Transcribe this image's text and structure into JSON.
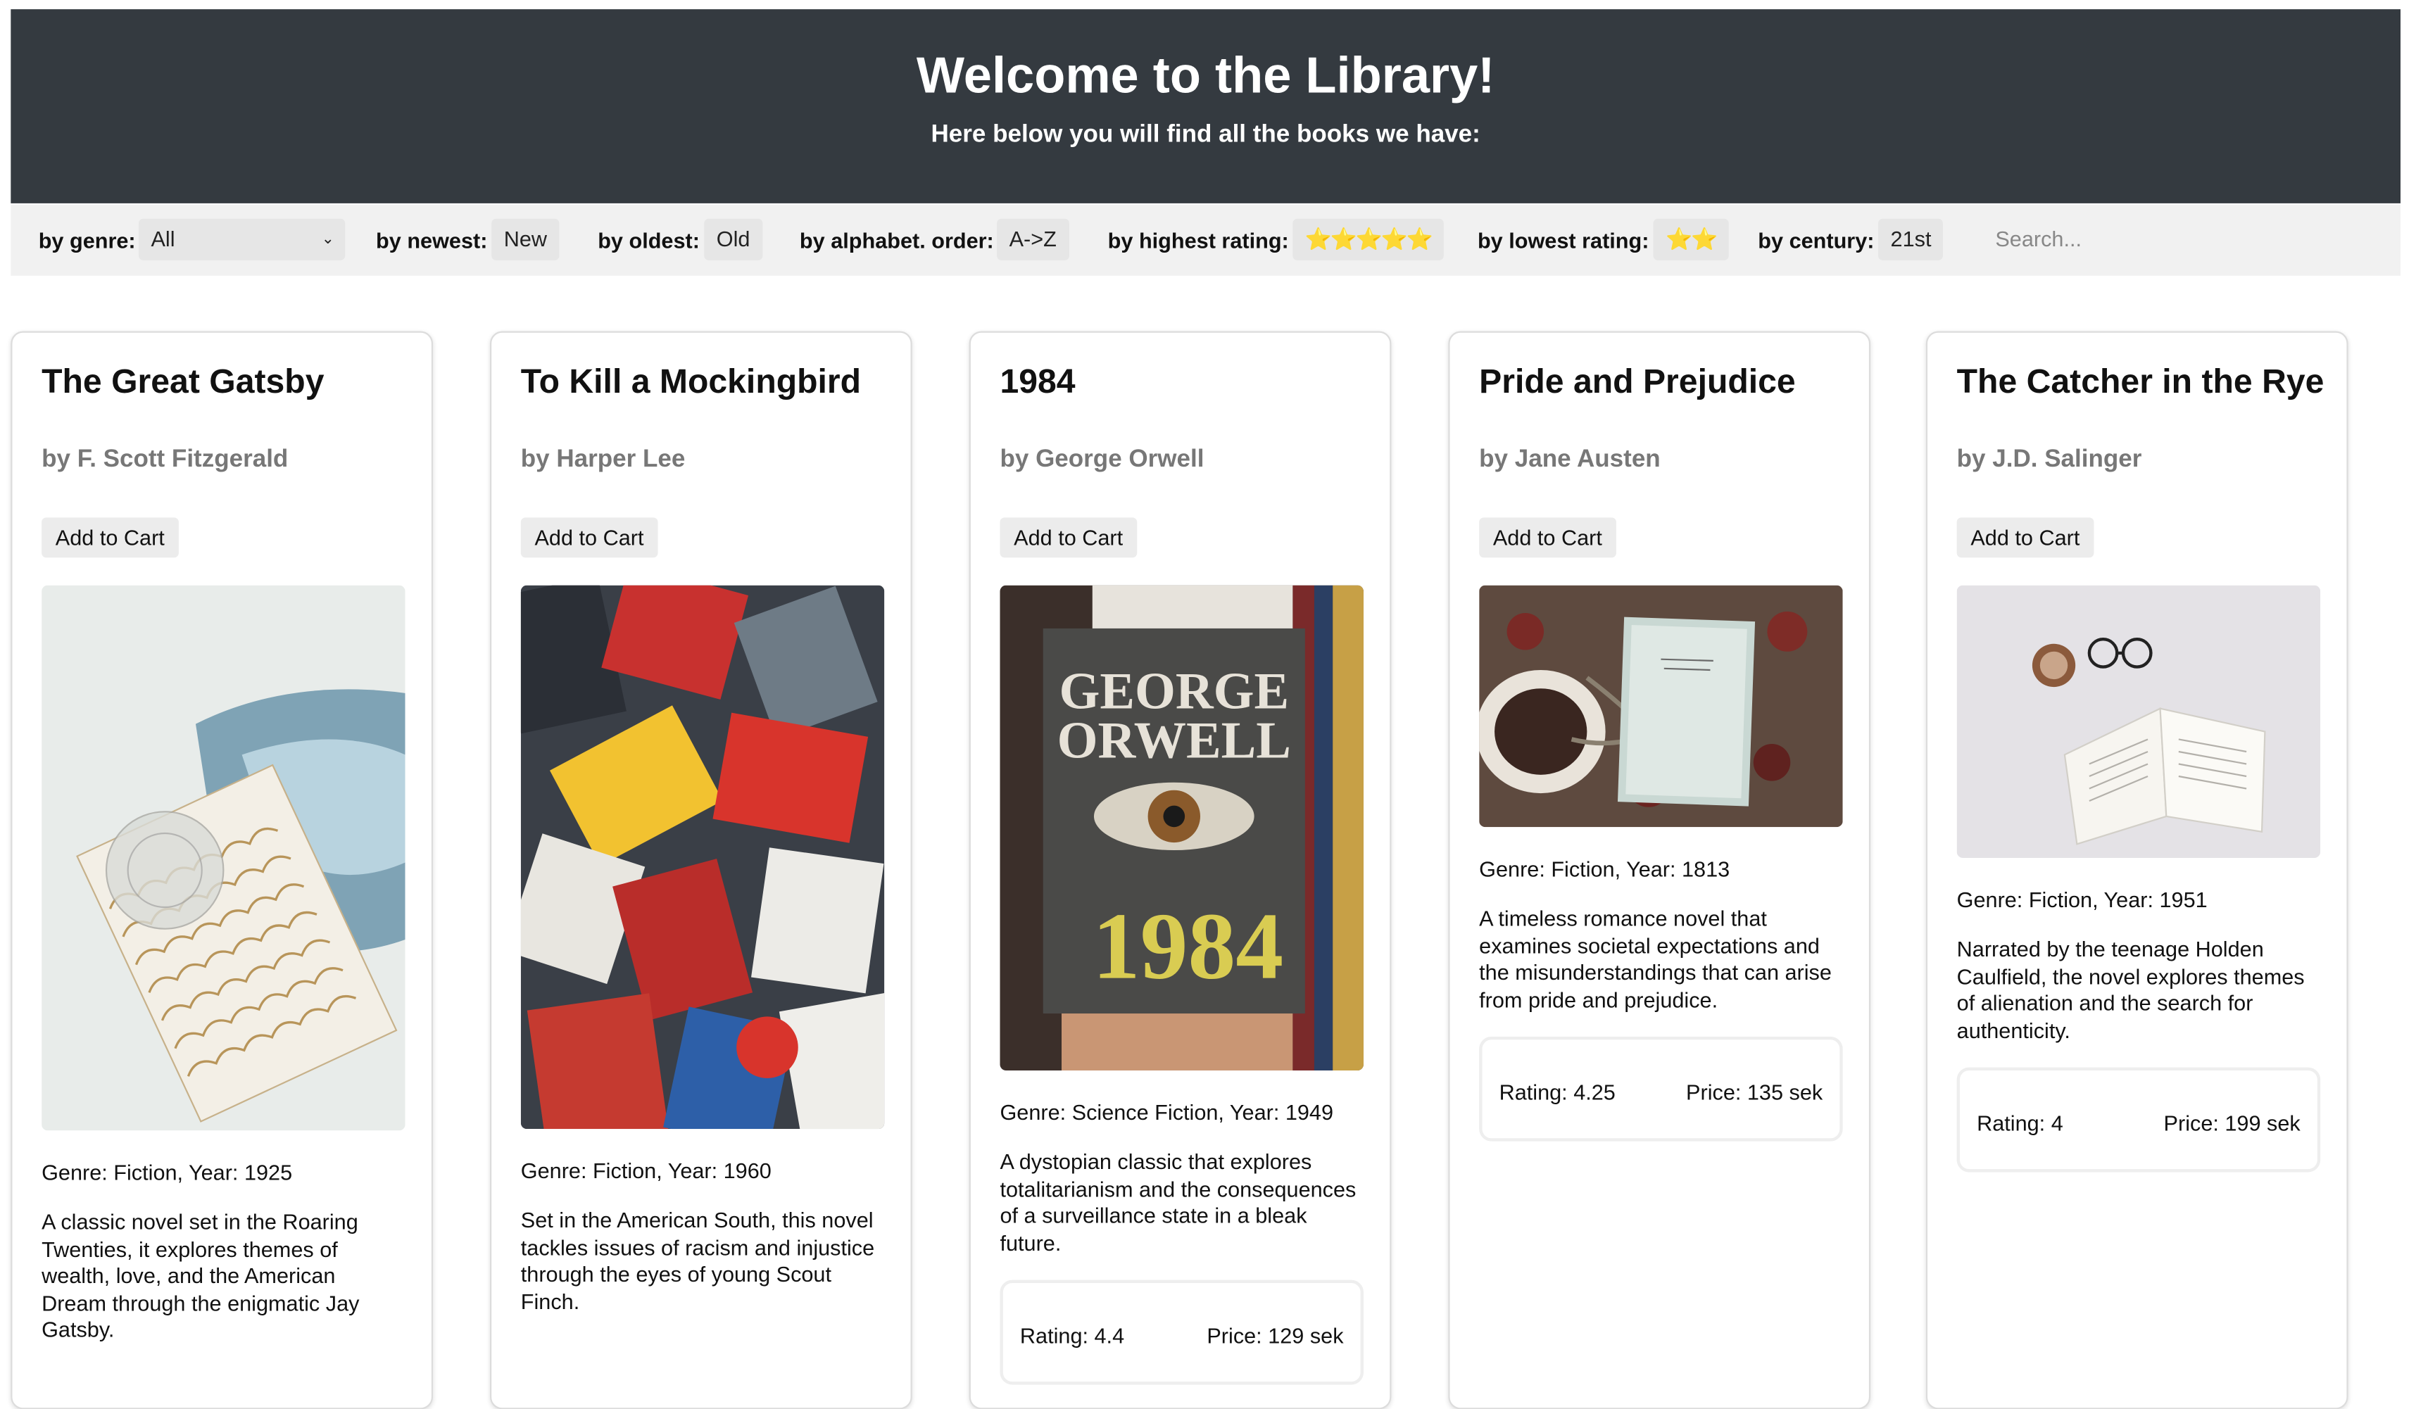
{
  "header": {
    "title": "Welcome to the Library!",
    "subtitle": "Here below you will find all the books we have:"
  },
  "filters": {
    "genre_label": "by genre:",
    "genre_value": "All",
    "newest_label": "by newest:",
    "newest_btn": "New",
    "oldest_label": "by oldest:",
    "oldest_btn": "Old",
    "alpha_label": "by alphabet. order:",
    "alpha_btn": "A->Z",
    "highest_label": "by highest rating:",
    "highest_btn": "⭐⭐⭐⭐⭐",
    "lowest_label": "by lowest rating:",
    "lowest_btn": "⭐⭐",
    "century_label": "by century:",
    "century_btn": "21st",
    "search_placeholder": "Search..."
  },
  "books": [
    {
      "title": "The Great Gatsby",
      "author": "by F. Scott Fitzgerald",
      "cart": "Add to Cart",
      "meta": "Genre: Fiction, Year: 1925",
      "description": "A classic novel set in the Roaring Twenties, it explores themes of wealth, love, and the American Dream through the enigmatic Jay Gatsby.",
      "rating": "",
      "price": ""
    },
    {
      "title": "To Kill a Mockingbird",
      "author": "by Harper Lee",
      "cart": "Add to Cart",
      "meta": "Genre: Fiction, Year: 1960",
      "description": "Set in the American South, this novel tackles issues of racism and injustice through the eyes of young Scout Finch.",
      "rating": "",
      "price": ""
    },
    {
      "title": "1984",
      "author": "by George Orwell",
      "cart": "Add to Cart",
      "meta": "Genre: Science Fiction, Year: 1949",
      "description": "A dystopian classic that explores totalitarianism and the consequences of a surveillance state in a bleak future.",
      "rating": "Rating: 4.4",
      "price": "Price: 129 sek",
      "cover_text_1": "GEORGE",
      "cover_text_2": "ORWELL",
      "cover_text_3": "1984"
    },
    {
      "title": "Pride and Prejudice",
      "author": "by Jane Austen",
      "cart": "Add to Cart",
      "meta": "Genre: Fiction, Year: 1813",
      "description": "A timeless romance novel that examines societal expectations and the misunderstandings that can arise from pride and prejudice.",
      "rating": "Rating: 4.25",
      "price": "Price: 135 sek"
    },
    {
      "title": "The Catcher in the Rye",
      "author": "by J.D. Salinger",
      "cart": "Add to Cart",
      "meta": "Genre: Fiction, Year: 1951",
      "description": "Narrated by the teenage Holden Caulfield, the novel explores themes of alienation and the search for authenticity.",
      "rating": "Rating: 4",
      "price": "Price: 199 sek"
    }
  ],
  "colors": {
    "header_bg": "#343a40",
    "filter_bg": "#f1f1f1",
    "button_bg": "#e6e6e6",
    "author_text": "#777777"
  }
}
